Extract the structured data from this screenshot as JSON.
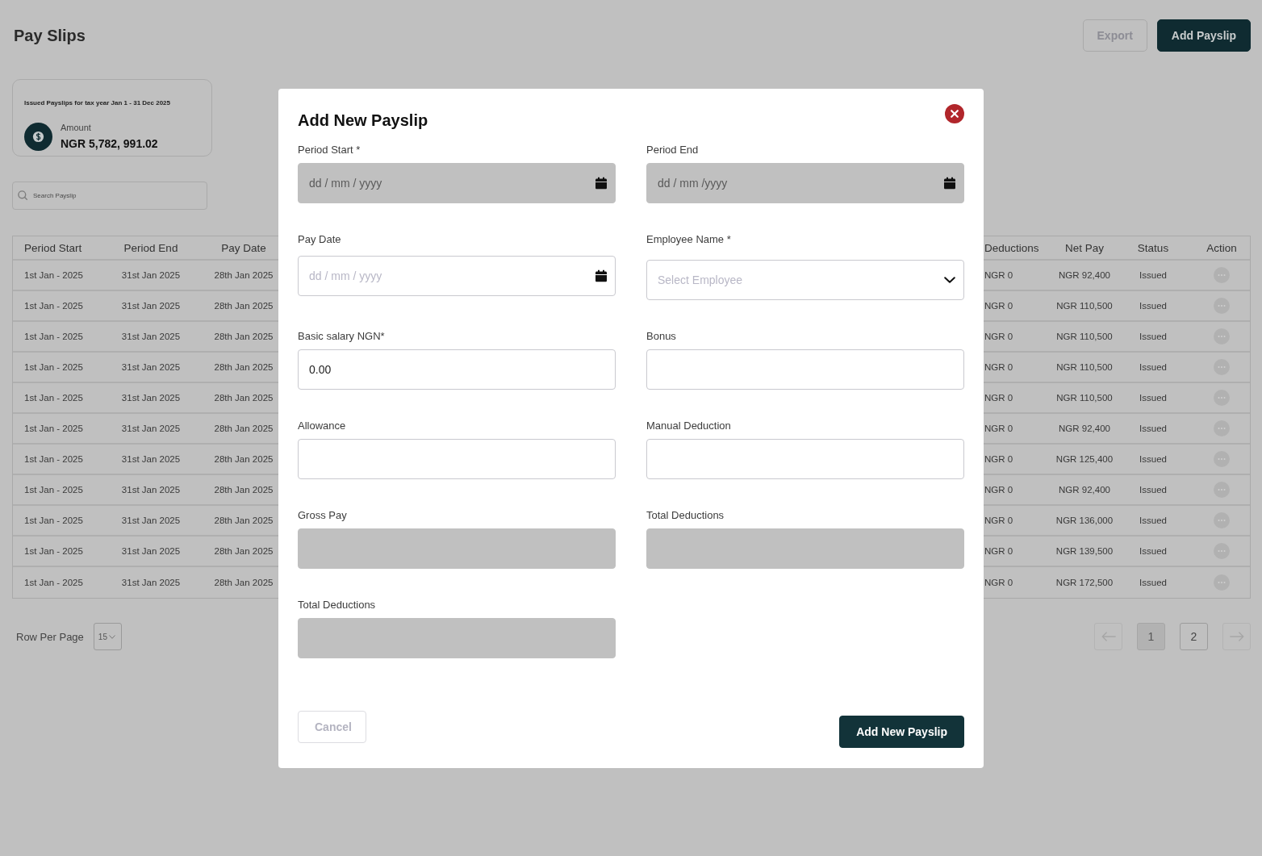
{
  "page": {
    "title": "Pay Slips",
    "actions": [
      {
        "label": "Export",
        "kind": "secondary"
      },
      {
        "label": "Add Payslip",
        "kind": "primary"
      }
    ]
  },
  "summary_card": {
    "title": "Issued Payslips for tax year Jan 1 - 31 Dec 2025",
    "label": "Amount",
    "value": "NGR 5,782, 991.02"
  },
  "search": {
    "placeholder": "Search Payslip"
  },
  "table": {
    "columns": [
      "Period Start",
      "Period End",
      "Pay Date",
      "Deductions",
      "Net Pay",
      "Status",
      "Action"
    ],
    "rows": [
      {
        "period_start": "1st Jan - 2025",
        "period_end": "31st Jan 2025",
        "pay_date": "28th Jan 2025",
        "deductions": "NGR 0",
        "net_pay": "NGR 92,400",
        "status": "Issued"
      },
      {
        "period_start": "1st Jan - 2025",
        "period_end": "31st Jan 2025",
        "pay_date": "28th Jan 2025",
        "deductions": "NGR 0",
        "net_pay": "NGR 110,500",
        "status": "Issued"
      },
      {
        "period_start": "1st Jan - 2025",
        "period_end": "31st Jan 2025",
        "pay_date": "28th Jan 2025",
        "deductions": "NGR 0",
        "net_pay": "NGR 110,500",
        "status": "Issued"
      },
      {
        "period_start": "1st Jan - 2025",
        "period_end": "31st Jan 2025",
        "pay_date": "28th Jan 2025",
        "deductions": "NGR 0",
        "net_pay": "NGR 110,500",
        "status": "Issued"
      },
      {
        "period_start": "1st Jan - 2025",
        "period_end": "31st Jan 2025",
        "pay_date": "28th Jan 2025",
        "deductions": "NGR 0",
        "net_pay": "NGR 110,500",
        "status": "Issued"
      },
      {
        "period_start": "1st Jan - 2025",
        "period_end": "31st Jan 2025",
        "pay_date": "28th Jan 2025",
        "deductions": "NGR 0",
        "net_pay": "NGR 92,400",
        "status": "Issued"
      },
      {
        "period_start": "1st Jan - 2025",
        "period_end": "31st Jan 2025",
        "pay_date": "28th Jan 2025",
        "deductions": "NGR 0",
        "net_pay": "NGR 125,400",
        "status": "Issued"
      },
      {
        "period_start": "1st Jan - 2025",
        "period_end": "31st Jan 2025",
        "pay_date": "28th Jan 2025",
        "deductions": "NGR 0",
        "net_pay": "NGR 92,400",
        "status": "Issued"
      },
      {
        "period_start": "1st Jan - 2025",
        "period_end": "31st Jan 2025",
        "pay_date": "28th Jan 2025",
        "deductions": "NGR 0",
        "net_pay": "NGR 136,000",
        "status": "Issued"
      },
      {
        "period_start": "1st Jan - 2025",
        "period_end": "31st Jan 2025",
        "pay_date": "28th Jan 2025",
        "deductions": "NGR 0",
        "net_pay": "NGR 139,500",
        "status": "Issued"
      },
      {
        "period_start": "1st Jan - 2025",
        "period_end": "31st Jan 2025",
        "pay_date": "28th Jan 2025",
        "deductions": "NGR 0",
        "net_pay": "NGR 172,500",
        "status": "Issued"
      }
    ]
  },
  "pagination": {
    "label": "Row Per Page",
    "rows_per_page": "15",
    "pages": [
      {
        "label": "1",
        "selected": true
      },
      {
        "label": "2",
        "selected": false
      }
    ]
  },
  "modal": {
    "title": "Add New Payslip",
    "fields": [
      {
        "label": "Period Start *",
        "kind": "date",
        "placeholder": "dd / mm / yyyy",
        "disabled": true
      },
      {
        "label": "Period End",
        "kind": "date",
        "placeholder": "dd / mm /yyyy",
        "disabled": true
      },
      {
        "label": "Pay Date",
        "kind": "date",
        "placeholder": "dd / mm / yyyy",
        "disabled": false
      },
      {
        "label": "Employee Name *",
        "kind": "select",
        "placeholder": "Select Employee",
        "disabled": false
      },
      {
        "label": "Basic salary NGN*",
        "kind": "text",
        "value": "0.00",
        "disabled": false
      },
      {
        "label": "Bonus",
        "kind": "text",
        "disabled": false
      },
      {
        "label": "Allowance",
        "kind": "text",
        "disabled": false
      },
      {
        "label": "Manual Deduction",
        "kind": "text",
        "disabled": false
      },
      {
        "label": "Gross Pay",
        "kind": "text",
        "disabled": true
      },
      {
        "label": "Total Deductions",
        "kind": "text",
        "disabled": true
      },
      {
        "label": "Total Deductions",
        "kind": "text",
        "disabled": true
      }
    ],
    "buttons": [
      {
        "label": "Cancel",
        "kind": "secondary"
      },
      {
        "label": "Add New Payslip",
        "kind": "primary"
      }
    ]
  }
}
